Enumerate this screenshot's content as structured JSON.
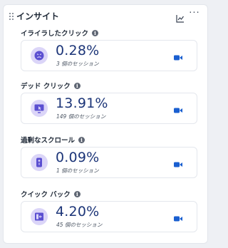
{
  "panel": {
    "title": "インサイト",
    "icons": {
      "drag": "drag-handle-icon",
      "chart": "line-chart-icon",
      "more": "more-horizontal-icon"
    },
    "more_label": "···"
  },
  "metrics": [
    {
      "label": "イライラしたクリック",
      "value": "0.28%",
      "sessions": "3 個のセッション",
      "icon": "angry-face-icon"
    },
    {
      "label": "デッド クリック",
      "value": "13.91%",
      "sessions": "149 個のセッション",
      "icon": "dead-click-icon"
    },
    {
      "label": "過剰なスクロール",
      "value": "0.09%",
      "sessions": "1 個のセッション",
      "icon": "scroll-icon"
    },
    {
      "label": "クイック バック",
      "value": "4.20%",
      "sessions": "45 個のセッション",
      "icon": "quick-back-icon"
    }
  ],
  "info_glyph": "i",
  "colors": {
    "accent": "#1a5fd0",
    "value_text": "#1c3578",
    "icon_bg": "#dbd5f8",
    "icon_fg": "#5b4fd1"
  }
}
